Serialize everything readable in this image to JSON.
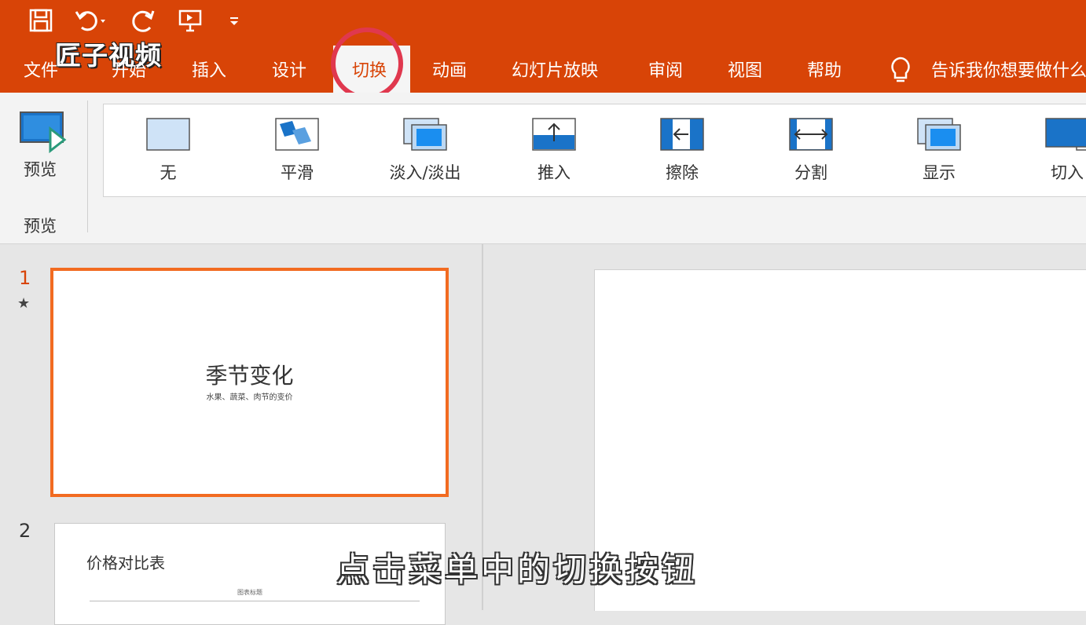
{
  "quick_access": {
    "icons": [
      "save-icon",
      "undo-icon",
      "redo-icon",
      "present-icon",
      "customize-icon"
    ]
  },
  "watermark": "匠子视频",
  "tabs": [
    "文件",
    "开始",
    "插入",
    "设计",
    "切换",
    "动画",
    "幻灯片放映",
    "审阅",
    "视图",
    "帮助"
  ],
  "active_tab": "切换",
  "tell_me": "告诉我你想要做什么",
  "ribbon": {
    "preview_button": "预览",
    "preview_group": "预览",
    "transitions": [
      "无",
      "平滑",
      "淡入/淡出",
      "推入",
      "擦除",
      "分割",
      "显示",
      "切入"
    ]
  },
  "slides": [
    {
      "number": "1",
      "title": "季节变化",
      "subtitle": "水果、蔬菜、肉节的变价"
    },
    {
      "number": "2",
      "title": "价格对比表",
      "chart_title": "图表标题"
    }
  ],
  "caption": "点击菜单中的切换按钮",
  "colors": {
    "accent": "#d84407",
    "selection": "#f26b21",
    "highlight_circle": "#e0384e"
  }
}
